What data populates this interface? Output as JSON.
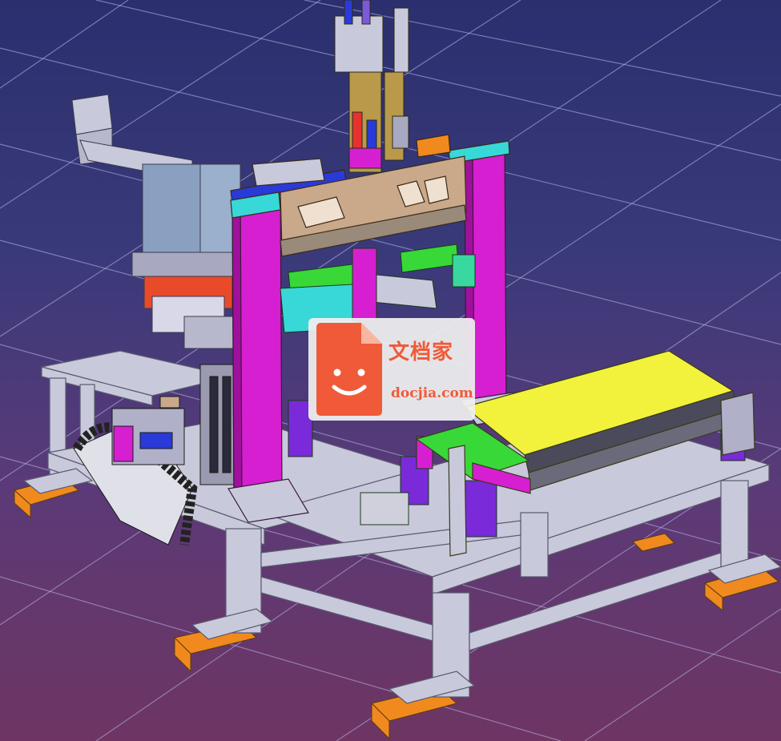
{
  "scene": {
    "subject": "cad-assembly-viewport",
    "colors": {
      "background_top": "#2b2f6e",
      "background_bottom": "#6e3562",
      "grid": "#b8b8e8",
      "frame": "#c9c9dc",
      "frame_edge": "#5a5a6e",
      "pillar": "#d61fd0",
      "beam": "#c9a98a",
      "conveyor": "#f2f23c",
      "feet": "#f08a1e",
      "blue_bar": "#2a3ad8",
      "cyan": "#38d8d8",
      "green": "#38d838"
    }
  },
  "watermark": {
    "chinese_text": "文档家",
    "url_text": "docjia.com",
    "accent_color": "#f05a38"
  }
}
